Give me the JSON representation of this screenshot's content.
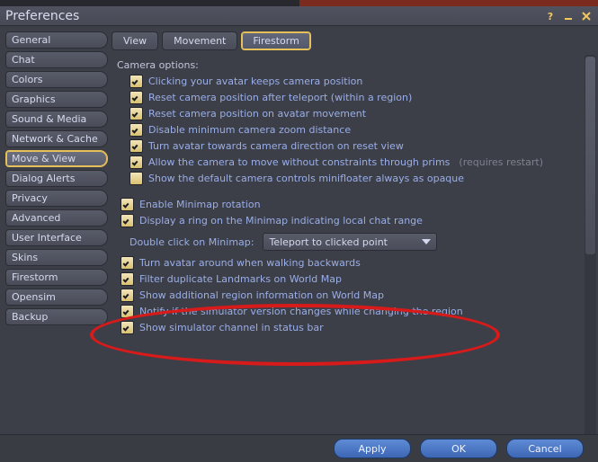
{
  "window": {
    "title": "Preferences"
  },
  "sidebar": {
    "items": [
      {
        "label": "General"
      },
      {
        "label": "Chat"
      },
      {
        "label": "Colors"
      },
      {
        "label": "Graphics"
      },
      {
        "label": "Sound & Media"
      },
      {
        "label": "Network & Cache"
      },
      {
        "label": "Move & View"
      },
      {
        "label": "Dialog Alerts"
      },
      {
        "label": "Privacy"
      },
      {
        "label": "Advanced"
      },
      {
        "label": "User Interface"
      },
      {
        "label": "Skins"
      },
      {
        "label": "Firestorm"
      },
      {
        "label": "Opensim"
      },
      {
        "label": "Backup"
      }
    ],
    "selected_index": 6
  },
  "tabs": {
    "items": [
      {
        "label": "View"
      },
      {
        "label": "Movement"
      },
      {
        "label": "Firestorm"
      }
    ],
    "selected_index": 2
  },
  "sections": {
    "camera_heading": "Camera options:",
    "camera": [
      {
        "label": "Clicking your avatar keeps camera position",
        "checked": true
      },
      {
        "label": "Reset camera position after teleport (within a region)",
        "checked": true
      },
      {
        "label": "Reset camera position on avatar movement",
        "checked": true
      },
      {
        "label": "Disable minimum camera zoom distance",
        "checked": true
      },
      {
        "label": "Turn avatar towards camera direction on reset view",
        "checked": true
      },
      {
        "label": "Allow the camera to move without constraints through prims",
        "checked": true,
        "hint": "(requires restart)"
      },
      {
        "label": "Show the default camera controls minifloater always as opaque",
        "checked": false
      }
    ],
    "minimap": [
      {
        "label": "Enable Minimap rotation",
        "checked": true
      },
      {
        "label": "Display a ring on the Minimap indicating local chat range",
        "checked": true
      }
    ],
    "doubleclick_label": "Double click on Minimap:",
    "doubleclick_value": "Teleport to clicked point",
    "misc": [
      {
        "label": "Turn avatar around when walking backwards",
        "checked": true
      },
      {
        "label": "Filter duplicate Landmarks on World Map",
        "checked": true
      },
      {
        "label": "Show additional region information on World Map",
        "checked": true
      },
      {
        "label": "Notify if the simulator version changes while changing the region",
        "checked": true
      },
      {
        "label": "Show simulator channel in status bar",
        "checked": true
      }
    ]
  },
  "footer": {
    "apply": "Apply",
    "ok": "OK",
    "cancel": "Cancel"
  }
}
